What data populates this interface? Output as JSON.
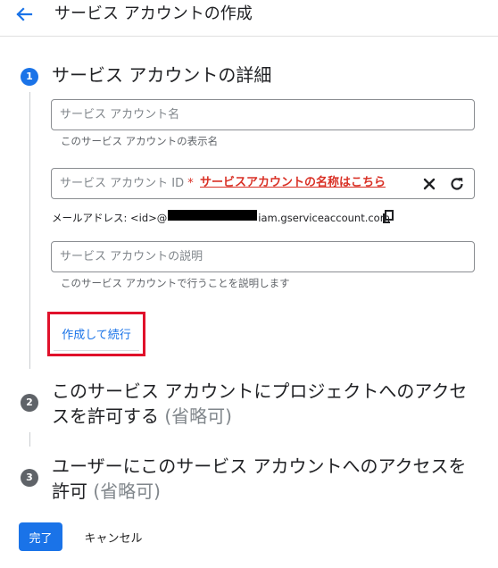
{
  "header": {
    "title": "サービス アカウントの作成",
    "back_icon": "arrow-back-icon"
  },
  "colors": {
    "accent": "#1a73e8",
    "annotation_red": "#d93025",
    "highlight_box": "#e0112b"
  },
  "steps": [
    {
      "number": "1",
      "title": "サービス アカウントの詳細"
    },
    {
      "number": "2",
      "title_line1": "このサービス アカウントにプロジェクトへのアクセ",
      "title_line2": "スを許可する",
      "optional": "(省略可)"
    },
    {
      "number": "3",
      "title_line1": "ユーザーにこのサービス アカウントへのアクセスを",
      "title_line2": "許可",
      "optional": "(省略可)"
    }
  ],
  "form": {
    "name": {
      "placeholder": "サービス アカウント名",
      "value": "",
      "hint": "このサービス アカウントの表示名"
    },
    "id": {
      "label": "サービス アカウント ID",
      "required_mark": "*",
      "annotation": "サービスアカウントの名称はこちら"
    },
    "email": {
      "prefix": "メールアドレス: <id>@",
      "suffix": "iam.gserviceaccount.com"
    },
    "description": {
      "placeholder": "サービス アカウントの説明",
      "value": "",
      "hint": "このサービス アカウントで行うことを説明します"
    },
    "create_button": "作成して続行"
  },
  "footer": {
    "done": "完了",
    "cancel": "キャンセル"
  }
}
